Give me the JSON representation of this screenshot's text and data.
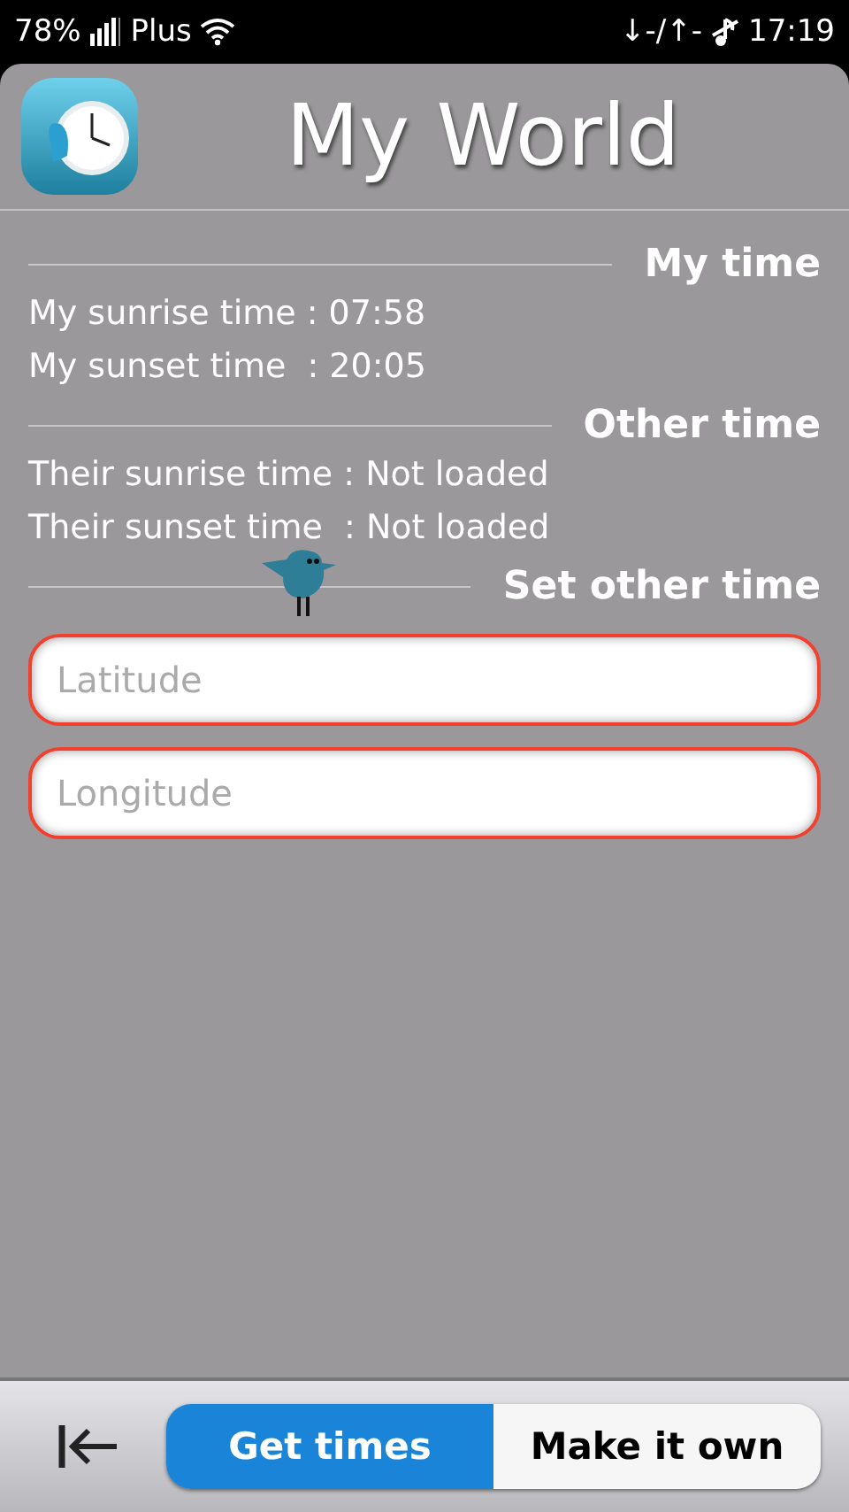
{
  "status_bar": {
    "battery": "78%",
    "carrier": "Plus",
    "data": "↓-/↑-",
    "time": "17:19"
  },
  "header": {
    "title": "My World"
  },
  "sections": [
    {
      "title": "My time",
      "lines": [
        "My sunrise time : 07:58",
        "My sunset time  : 20:05"
      ]
    },
    {
      "title": "Other time",
      "lines": [
        "Their sunrise time : Not loaded",
        "Their sunset time  : Not loaded"
      ]
    },
    {
      "title": "Set other time"
    }
  ],
  "fields": [
    {
      "placeholder": "Latitude"
    },
    {
      "placeholder": "Longitude"
    }
  ],
  "segments": [
    {
      "label": "Get times",
      "selected": true
    },
    {
      "label": "Make it own",
      "selected": false
    }
  ]
}
